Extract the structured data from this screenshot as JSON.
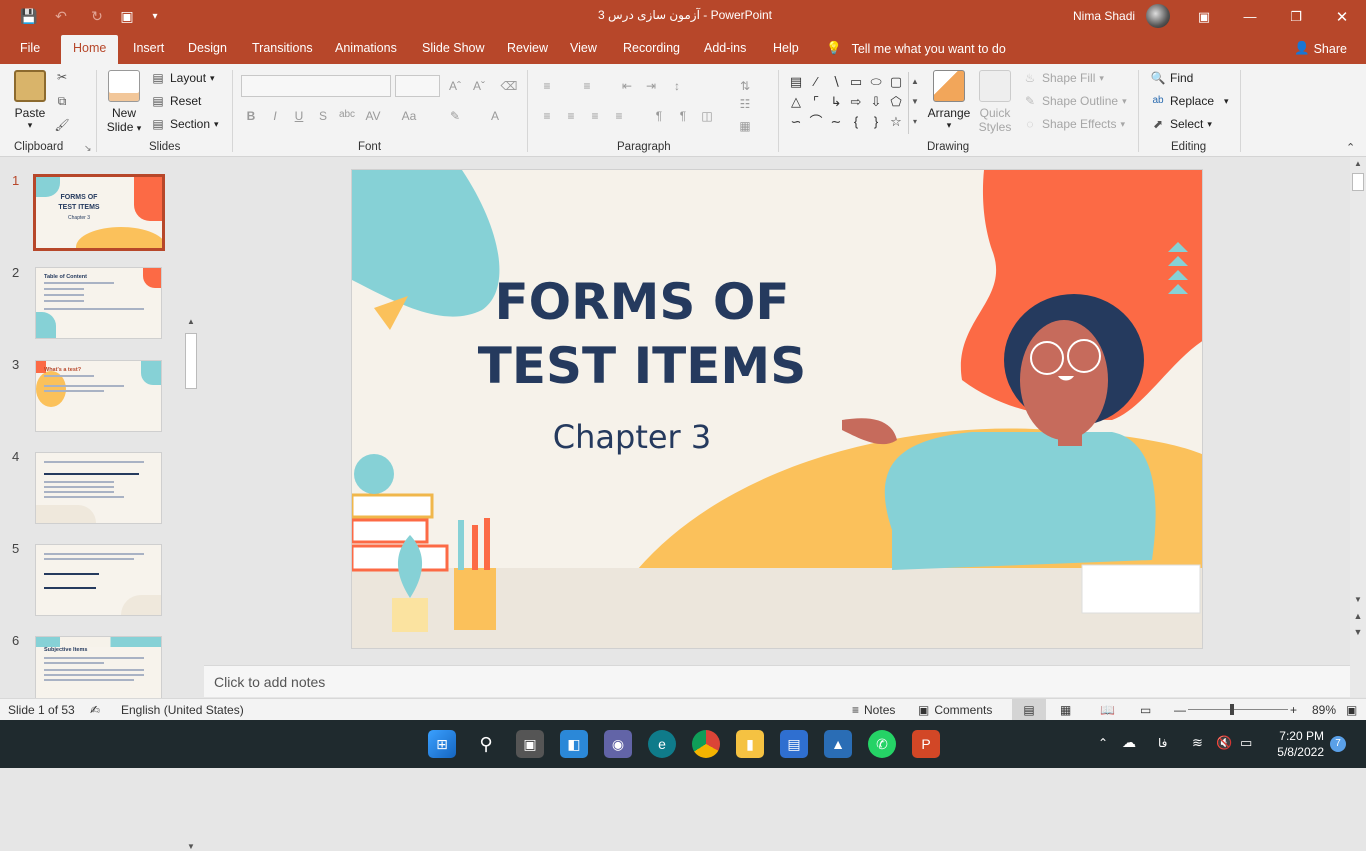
{
  "window": {
    "doc_title": "آزمون سازی درس 3",
    "app_title": "PowerPoint",
    "title_separator": "-",
    "user_name": "Nima Shadi"
  },
  "tabs": [
    "File",
    "Home",
    "Insert",
    "Design",
    "Transitions",
    "Animations",
    "Slide Show",
    "Review",
    "View",
    "Recording",
    "Add-ins",
    "Help"
  ],
  "tell_me": "Tell me what you want to do",
  "share": "Share",
  "ribbon": {
    "clipboard": {
      "label": "Clipboard",
      "paste": "Paste"
    },
    "slides": {
      "label": "Slides",
      "new_slide_1": "New",
      "new_slide_2": "Slide",
      "layout": "Layout",
      "reset": "Reset",
      "section": "Section"
    },
    "font": {
      "label": "Font"
    },
    "paragraph": {
      "label": "Paragraph"
    },
    "drawing": {
      "label": "Drawing",
      "arrange": "Arrange",
      "quick_styles_1": "Quick",
      "quick_styles_2": "Styles",
      "shape_fill": "Shape Fill",
      "shape_outline": "Shape Outline",
      "shape_effects": "Shape Effects"
    },
    "editing": {
      "label": "Editing",
      "find": "Find",
      "replace": "Replace",
      "select": "Select"
    }
  },
  "thumbnails": [
    {
      "num": "1",
      "title": "FORMS OF TEST ITEMS",
      "subtitle": "Chapter 3"
    },
    {
      "num": "2",
      "title": "Table of Content"
    },
    {
      "num": "3",
      "title": "What's a test?"
    },
    {
      "num": "4",
      "title": ""
    },
    {
      "num": "5",
      "title": ""
    },
    {
      "num": "6",
      "title": "Subjective Items"
    }
  ],
  "slide": {
    "title_line1": "FORMS OF",
    "title_line2": "TEST ITEMS",
    "subtitle": "Chapter 3"
  },
  "notes_placeholder": "Click to add notes",
  "status": {
    "slide_info": "Slide 1 of 53",
    "language": "English (United States)",
    "notes": "Notes",
    "comments": "Comments",
    "zoom": "89%"
  },
  "taskbar": {
    "time": "7:20 PM",
    "date": "5/8/2022",
    "lang": "فا",
    "notif": "7"
  },
  "colors": {
    "accent": "#b7472a",
    "navy": "#253a5e",
    "orange": "#fc6a45",
    "teal": "#86d1d6",
    "yellow": "#fbc15b"
  }
}
